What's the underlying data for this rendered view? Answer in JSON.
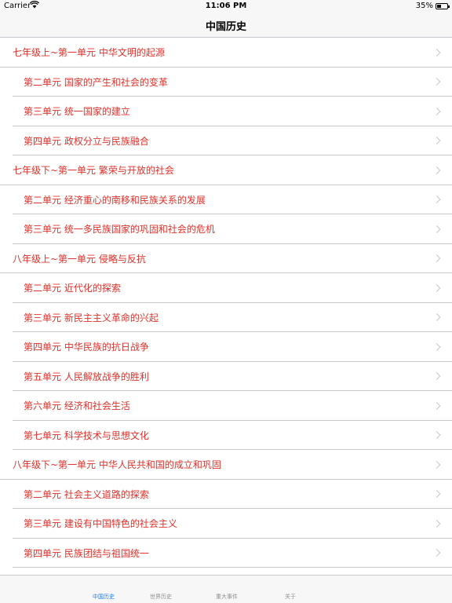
{
  "status_bar": {
    "carrier": "Carrier",
    "time": "11:06 PM",
    "battery": "35%"
  },
  "nav": {
    "title": "中国历史"
  },
  "units": [
    {
      "label": "七年级上~第一单元 中华文明的起源",
      "level": 1
    },
    {
      "label": "第二单元 国家的产生和社会的变革",
      "level": 2
    },
    {
      "label": "第三单元 统一国家的建立",
      "level": 2
    },
    {
      "label": "第四单元 政权分立与民族融合",
      "level": 2
    },
    {
      "label": "七年级下~第一单元 繁荣与开放的社会",
      "level": 1
    },
    {
      "label": "第二单元 经济重心的南移和民族关系的发展",
      "level": 2
    },
    {
      "label": "第三单元 统一多民族国家的巩固和社会的危机",
      "level": 2
    },
    {
      "label": "八年级上~第一单元 侵略与反抗",
      "level": 1
    },
    {
      "label": "第二单元 近代化的探索",
      "level": 2
    },
    {
      "label": "第三单元 新民主主义革命的兴起",
      "level": 2
    },
    {
      "label": "第四单元 中华民族的抗日战争",
      "level": 2
    },
    {
      "label": "第五单元 人民解放战争的胜利",
      "level": 2
    },
    {
      "label": "第六单元 经济和社会生活",
      "level": 2
    },
    {
      "label": "第七单元 科学技术与思想文化",
      "level": 2
    },
    {
      "label": "八年级下~第一单元 中华人民共和国的成立和巩固",
      "level": 1
    },
    {
      "label": "第二单元 社会主义道路的探索",
      "level": 2
    },
    {
      "label": "第三单元 建设有中国特色的社会主义",
      "level": 2
    },
    {
      "label": "第四单元 民族团结与祖国统一",
      "level": 2
    }
  ],
  "tabs": [
    {
      "label": "中国历史",
      "active": true
    },
    {
      "label": "世界历史",
      "active": false
    },
    {
      "label": "重大事件",
      "active": false
    },
    {
      "label": "关于",
      "active": false
    }
  ],
  "colors": {
    "unit_text": "#e1302a",
    "tab_active": "#1a7cf5",
    "tab_inactive": "#8e8e93"
  }
}
